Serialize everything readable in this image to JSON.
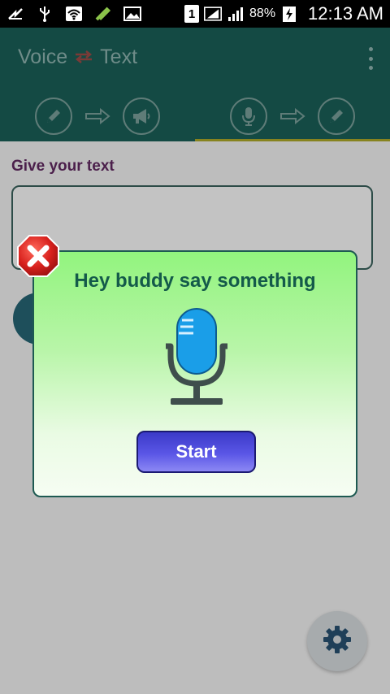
{
  "status_bar": {
    "sim_slot": "1",
    "battery": "88%",
    "time": "12:13 AM",
    "icons": [
      "usb-tethering-icon",
      "usb-icon",
      "wifi-icon",
      "edit-slash-icon",
      "image-icon",
      "signal-icon",
      "signal-icon",
      "battery-charging-icon"
    ]
  },
  "app_bar": {
    "title_left": "Voice",
    "title_right": "Text",
    "swap_icon": "swap-arrows-icon",
    "menu_icon": "more-vert-icon",
    "tabs": [
      {
        "icons": [
          "pencil-icon",
          "arrow-right-icon",
          "megaphone-icon"
        ],
        "active": false
      },
      {
        "icons": [
          "microphone-icon",
          "arrow-right-icon",
          "pencil-icon"
        ],
        "active": true
      }
    ]
  },
  "content": {
    "label": "Give your text",
    "text_value": "",
    "settings_icon": "gear-icon"
  },
  "dialog": {
    "title": "Hey buddy say something",
    "start_label": "Start",
    "close_icon": "close-icon",
    "mic_icon": "microphone-icon"
  },
  "colors": {
    "app_bar": "#144a44",
    "tab_indicator": "#87831f",
    "dialog_top": "#92f47e",
    "dialog_title": "#145a4a",
    "start_button": "#3b3ac8",
    "close_red": "#d8211d",
    "mic_blue": "#1a9ee8"
  }
}
